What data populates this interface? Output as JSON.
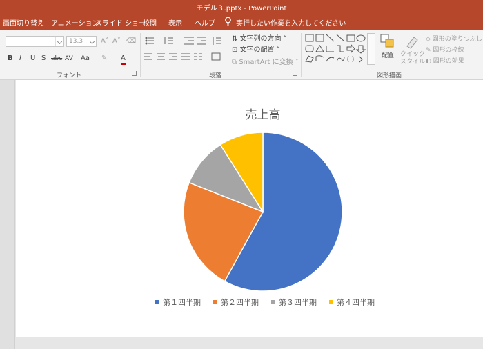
{
  "titlebar": {
    "title": "モデル３.pptx  -  PowerPoint"
  },
  "menu": {
    "tabs": [
      {
        "label": "画面切り替え"
      },
      {
        "label": "アニメーション"
      },
      {
        "label": "スライド ショー"
      },
      {
        "label": "校閲"
      },
      {
        "label": "表示"
      },
      {
        "label": "ヘルプ"
      }
    ],
    "tell_me": "実行したい作業を入力してください"
  },
  "ribbon": {
    "font_group_label": "フォント",
    "paragraph_group_label": "段落",
    "drawing_group_label": "図形描画",
    "font_size": "13.3",
    "bold": "B",
    "italic": "I",
    "underline": "U",
    "strike": "S",
    "abc": "abc",
    "spacing": "AV",
    "case": "Aa",
    "text_direction": "文字列の方向",
    "align_text": "文字の配置",
    "smartart": "SmartArt に変換",
    "arrange": "配置",
    "quick_styles": "クイック\nスタイル",
    "shape_fill": "図形の塗りつぶし",
    "shape_outline": "図形の枠線",
    "shape_effects": "図形の効果"
  },
  "chart_data": {
    "type": "pie",
    "title": "売上高",
    "categories": [
      "第１四半期",
      "第２四半期",
      "第３四半期",
      "第４四半期"
    ],
    "values": [
      58,
      23,
      10,
      9
    ],
    "colors": [
      "#4472c4",
      "#ed7d31",
      "#a5a5a5",
      "#ffc000"
    ],
    "legend": "bottom"
  }
}
